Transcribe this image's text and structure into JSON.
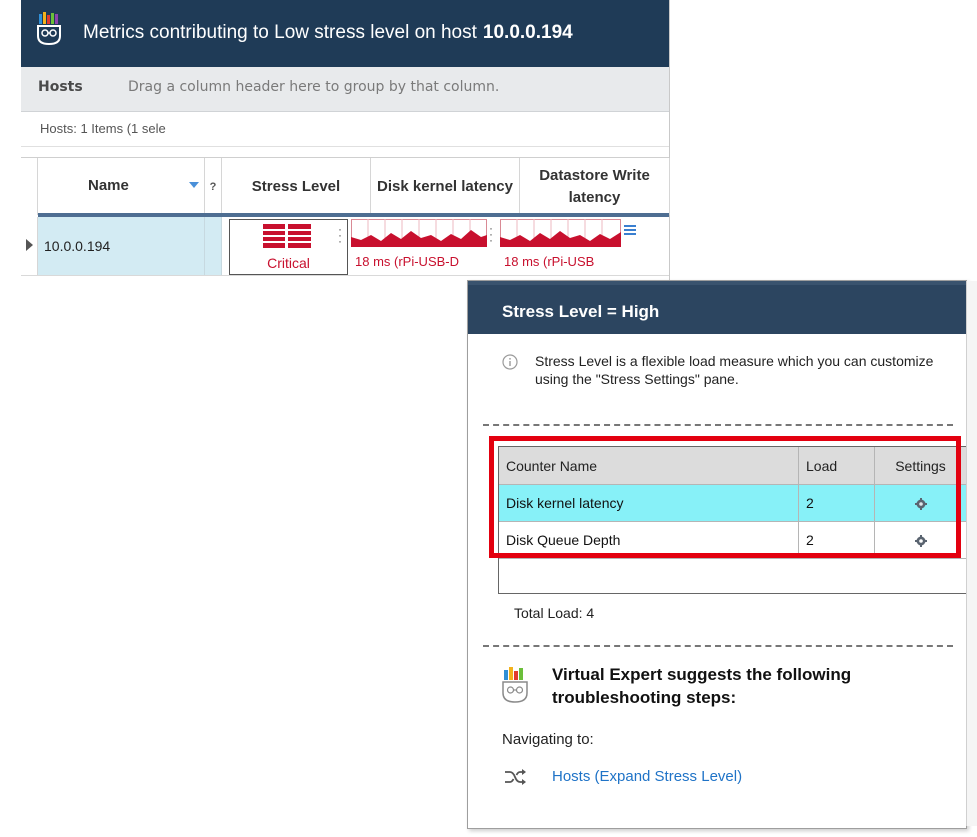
{
  "window": {
    "title": "Metrics contributing to Low stress level on host",
    "host": "10.0.0.194"
  },
  "groupbar": {
    "tab_label": "Hosts",
    "hint": "Drag a column header here to group by that column."
  },
  "grid": {
    "item_count": "Hosts: 1 Items (1 sele",
    "columns": {
      "name": "Name",
      "collapsed_marker": "?",
      "stress_level": "Stress Level",
      "disk_kernel": "Disk kernel latency",
      "datastore_write": "Datastore Write latency"
    },
    "row": {
      "name": "10.0.0.194",
      "stress": "Critical",
      "disk_kernel": "18 ms (rPi-USB-D",
      "datastore_write": "18 ms (rPi-USB"
    },
    "status_color": "#c8102e"
  },
  "popup": {
    "title": "Stress Level = High",
    "info": "Stress Level is a flexible load measure which you can customize using the \"Stress Settings\" pane.",
    "table": {
      "headers": [
        "Counter Name",
        "Load",
        "Settings"
      ],
      "rows": [
        {
          "name": "Disk kernel latency",
          "load": "2",
          "selected": true
        },
        {
          "name": "Disk Queue Depth",
          "load": "2",
          "selected": false
        }
      ]
    },
    "total_load": "Total Load: 4",
    "suggestion": "Virtual Expert suggests the following troubleshooting steps:",
    "navigating_label": "Navigating to:",
    "nav_link": "Hosts (Expand Stress Level)",
    "highlight_color": "#e3000f"
  }
}
